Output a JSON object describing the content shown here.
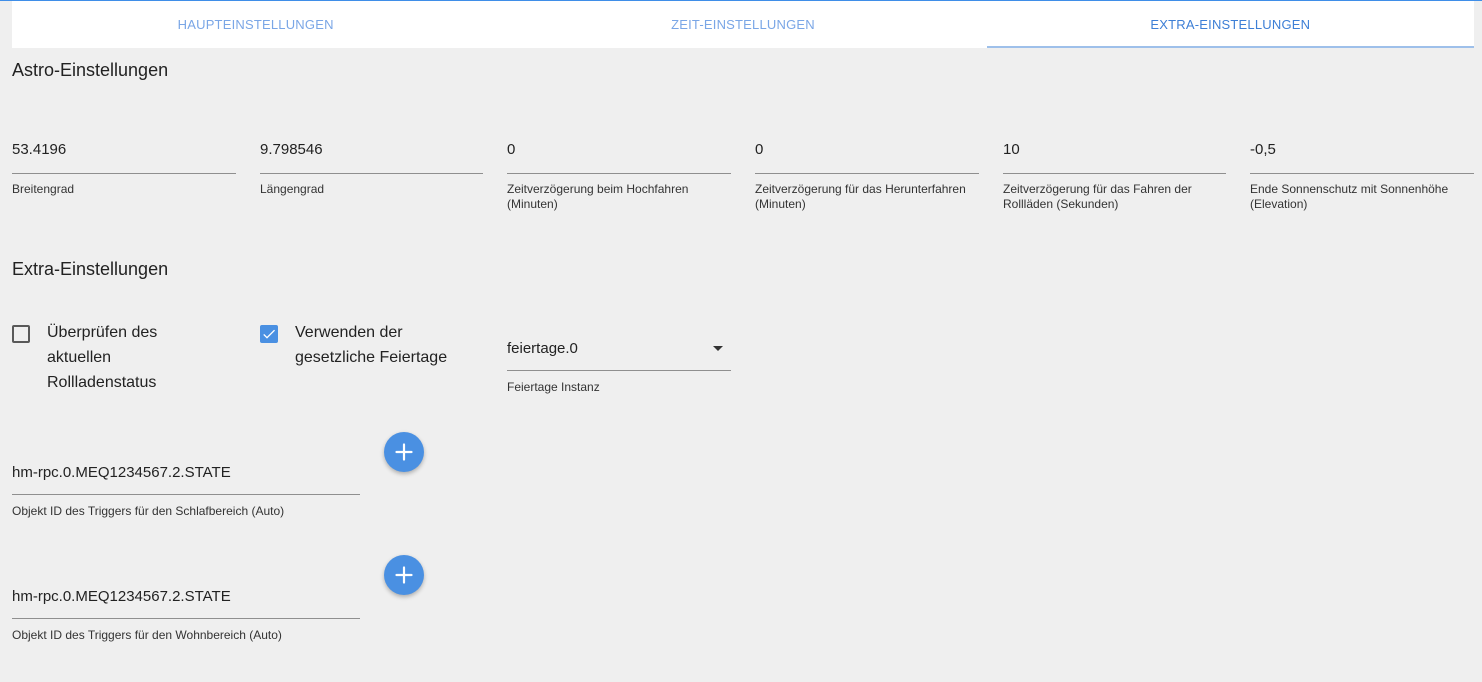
{
  "colors": {
    "accent": "#4a90e2",
    "tab_text": "#7aa6e6",
    "background": "#efefef"
  },
  "tabs": [
    {
      "label": "HAUPTEINSTELLUNGEN",
      "active": false
    },
    {
      "label": "ZEIT-EINSTELLUNGEN",
      "active": false
    },
    {
      "label": "EXTRA-EINSTELLUNGEN",
      "active": true
    }
  ],
  "astro": {
    "title": "Astro-Einstellungen",
    "fields": [
      {
        "value": "53.4196",
        "label": "Breitengrad"
      },
      {
        "value": "9.798546",
        "label": "Längengrad"
      },
      {
        "value": "0",
        "label": "Zeitverzögerung beim Hochfahren (Minuten)"
      },
      {
        "value": "0",
        "label": "Zeitverzögerung für das Herunterfahren (Minuten)"
      },
      {
        "value": "10",
        "label": "Zeitverzögerung für das Fahren der Rollläden (Sekunden)"
      },
      {
        "value": "-0,5",
        "label": "Ende Sonnenschutz mit Sonnenhöhe (Elevation)"
      }
    ]
  },
  "extra": {
    "title": "Extra-Einstellungen",
    "check_status": {
      "label": "Überprüfen des aktuellen Rollladenstatus",
      "checked": false
    },
    "holidays": {
      "label": "Verwenden der gesetzliche Feiertage",
      "checked": true
    },
    "holiday_instance": {
      "value": "feiertage.0",
      "label": "Feiertage Instanz"
    },
    "triggers": [
      {
        "value": "hm-rpc.0.MEQ1234567.2.STATE",
        "label": "Objekt ID des Triggers für den Schlafbereich (Auto)",
        "icon": "plus-icon"
      },
      {
        "value": "hm-rpc.0.MEQ1234567.2.STATE",
        "label": "Objekt ID des Triggers für den Wohnbereich (Auto)",
        "icon": "plus-icon"
      }
    ]
  }
}
